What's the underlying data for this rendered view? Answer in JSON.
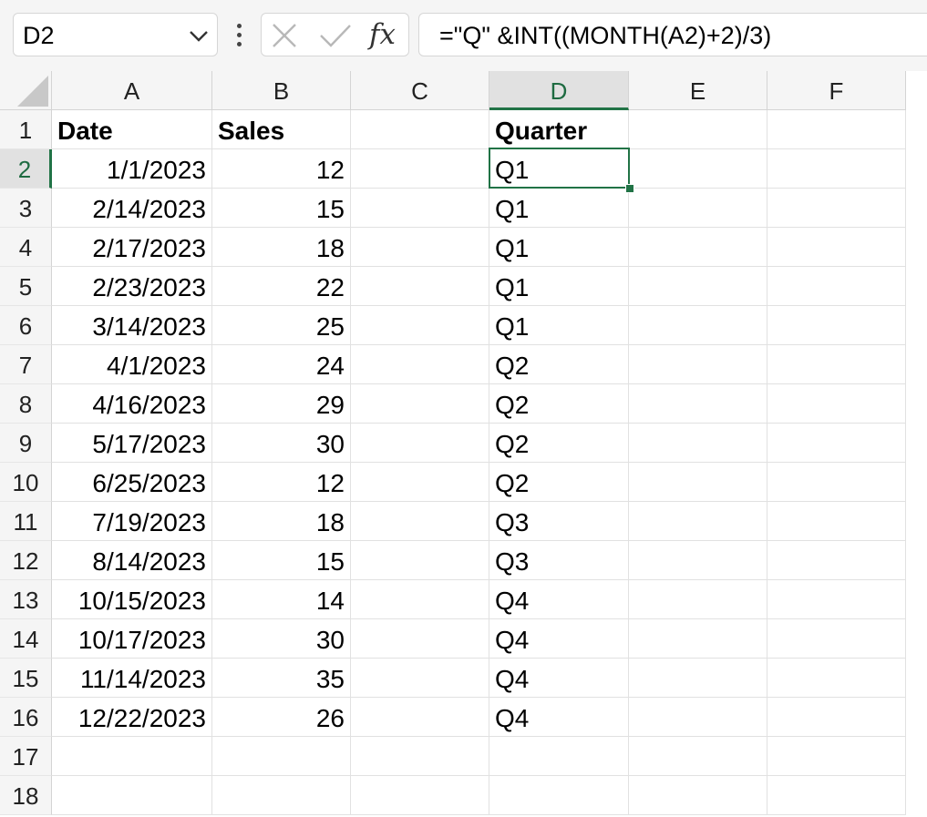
{
  "name_box": {
    "value": "D2",
    "dropdown_icon": "chevron-down-icon"
  },
  "formula_bar": {
    "menu_icon": "vertical-ellipsis-icon",
    "cancel_icon": "close-icon",
    "enter_icon": "checkmark-icon",
    "fx_label": "fx",
    "formula": "=\"Q\" &INT((MONTH(A2)+2)/3)"
  },
  "colors": {
    "accent": "#217346",
    "header_bg": "#f5f5f5",
    "active_header_bg": "#e1e1e1",
    "gridline": "#e1e1e1"
  },
  "columns": [
    "A",
    "B",
    "C",
    "D",
    "E",
    "F"
  ],
  "active_column": "D",
  "active_row": 2,
  "row_numbers": [
    "1",
    "2",
    "3",
    "4",
    "5",
    "6",
    "7",
    "8",
    "9",
    "10",
    "11",
    "12",
    "13",
    "14",
    "15",
    "16",
    "17",
    "18"
  ],
  "cells": {
    "A": [
      "Date",
      "1/1/2023",
      "2/14/2023",
      "2/17/2023",
      "2/23/2023",
      "3/14/2023",
      "4/1/2023",
      "4/16/2023",
      "5/17/2023",
      "6/25/2023",
      "7/19/2023",
      "8/14/2023",
      "10/15/2023",
      "10/17/2023",
      "11/14/2023",
      "12/22/2023",
      "",
      ""
    ],
    "B": [
      "Sales",
      "12",
      "15",
      "18",
      "22",
      "25",
      "24",
      "29",
      "30",
      "12",
      "18",
      "15",
      "14",
      "30",
      "35",
      "26",
      "",
      ""
    ],
    "C": [
      "",
      "",
      "",
      "",
      "",
      "",
      "",
      "",
      "",
      "",
      "",
      "",
      "",
      "",
      "",
      "",
      "",
      ""
    ],
    "D": [
      "Quarter",
      "Q1",
      "Q1",
      "Q1",
      "Q1",
      "Q1",
      "Q2",
      "Q2",
      "Q2",
      "Q2",
      "Q3",
      "Q3",
      "Q4",
      "Q4",
      "Q4",
      "Q4",
      "",
      ""
    ],
    "E": [
      "",
      "",
      "",
      "",
      "",
      "",
      "",
      "",
      "",
      "",
      "",
      "",
      "",
      "",
      "",
      "",
      "",
      ""
    ],
    "F": [
      "",
      "",
      "",
      "",
      "",
      "",
      "",
      "",
      "",
      "",
      "",
      "",
      "",
      "",
      "",
      "",
      "",
      ""
    ]
  },
  "selected_cell": "D2"
}
